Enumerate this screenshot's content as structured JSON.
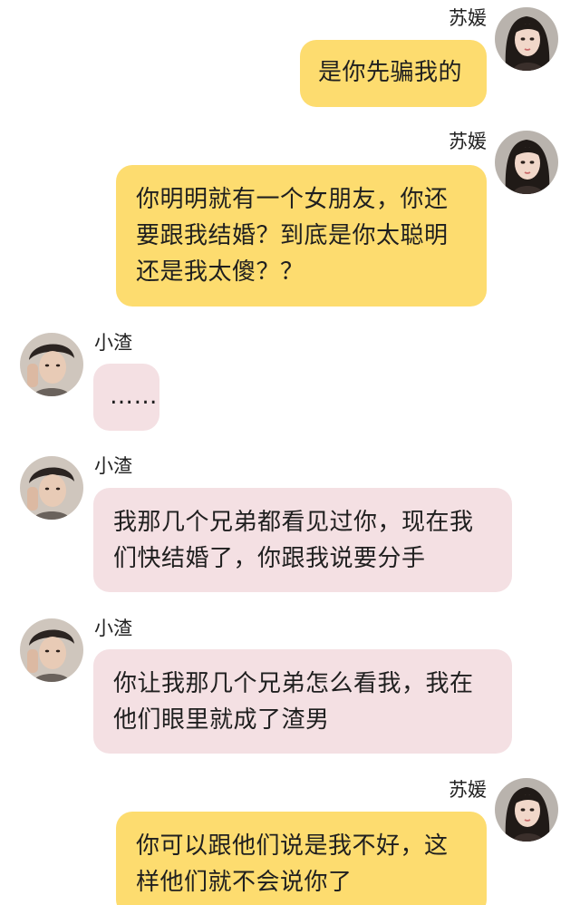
{
  "conversation": {
    "messages": [
      {
        "sender": "苏媛",
        "side": "right",
        "text": "是你先骗我的"
      },
      {
        "sender": "苏媛",
        "side": "right",
        "text": "你明明就有一个女朋友，你还要跟我结婚？到底是你太聪明还是我太傻？？"
      },
      {
        "sender": "小渣",
        "side": "left",
        "text": "……"
      },
      {
        "sender": "小渣",
        "side": "left",
        "text": "我那几个兄弟都看见过你，现在我们快结婚了，你跟我说要分手"
      },
      {
        "sender": "小渣",
        "side": "left",
        "text": "你让我那几个兄弟怎么看我，我在他们眼里就成了渣男"
      },
      {
        "sender": "苏媛",
        "side": "right",
        "text": "你可以跟他们说是我不好，这样他们就不会说你了"
      }
    ]
  },
  "colors": {
    "self_bubble": "#fddc6f",
    "other_bubble": "#f4e0e3"
  },
  "icons": {
    "female_avatar": "female-avatar-icon",
    "male_avatar": "male-avatar-icon"
  }
}
